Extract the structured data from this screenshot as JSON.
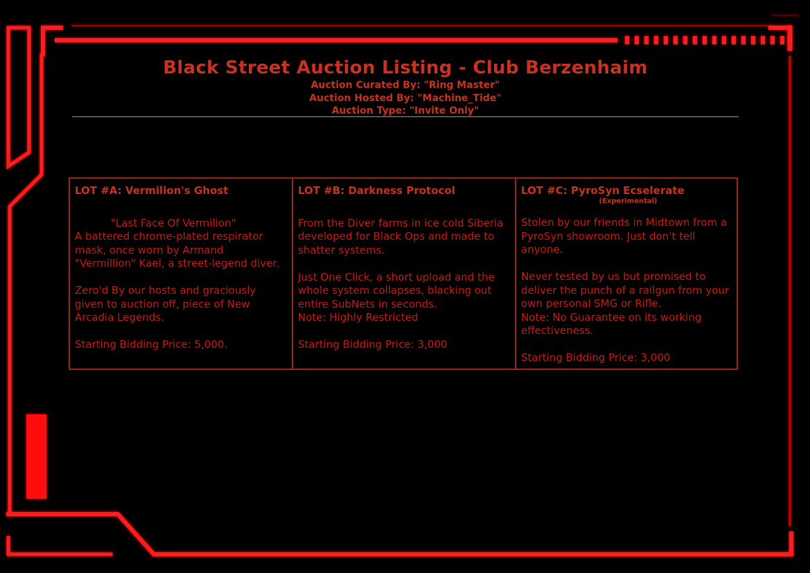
{
  "header": {
    "title": "Black Street Auction Listing - Club Berzenhaim",
    "curated": "Auction Curated By: \"Ring Master\"",
    "hosted": "Auction Hosted By: \"Machine_Tide\"",
    "type": "Auction Type: \"Invite Only\""
  },
  "lots": [
    {
      "title": "LOT #A: Vermilion's Ghost",
      "tagline": "\"Last Face Of Vermilion\"",
      "body1": "A battered chrome-plated respirator mask, once worn by Armand \"Vermillion\" Kael, a street-legend diver.",
      "body2": "Zero'd By our hosts and graciously given to auction off, piece of New Arcadia Legends.",
      "price": "Starting Bidding Price: 5,000."
    },
    {
      "title": "LOT #B: Darkness Protocol",
      "body1": "From the Diver farms in ice cold Siberia developed for Black Ops and made to shatter systems.",
      "body2": "Just One Click, a short upload and the whole system collapses, blacking out entire SubNets in seconds.",
      "note": "Note: Highly Restricted",
      "price": "Starting Bidding Price: 3,000"
    },
    {
      "title": "LOT #C: PyroSyn Ecselerate",
      "subtitle": "(Experimental)",
      "body1": "Stolen by our friends in Midtown from a PyroSyn showroom. Just don't tell anyone.",
      "body2": "Never tested by us but promised to deliver the punch of a railgun from your own personal SMG or Rifle.",
      "note": "Note: No Guarantee on its working effectiveness.",
      "price": "Starting Bidding Price: 3,000"
    }
  ],
  "colors": {
    "frame": "#ff0000",
    "text": "#c8321e",
    "border": "#9b2613",
    "background": "#000000"
  }
}
